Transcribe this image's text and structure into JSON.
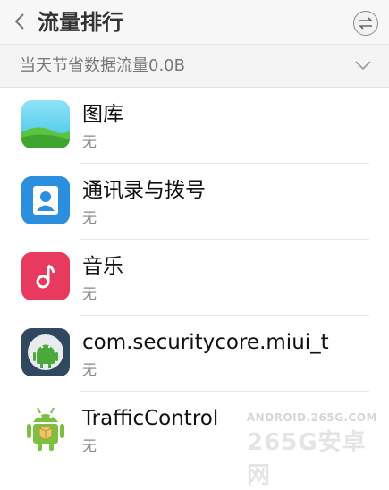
{
  "header": {
    "title": "流量排行",
    "back_icon": "chevron-left-icon",
    "sort_icon": "sort-arrows-icon"
  },
  "summary": {
    "text": "当天节省数据流量0.0B",
    "expand_icon": "chevron-down-icon"
  },
  "apps": [
    {
      "name": "图库",
      "usage": "无",
      "icon": "gallery-icon"
    },
    {
      "name": "通讯录与拨号",
      "usage": "无",
      "icon": "contacts-icon"
    },
    {
      "name": "音乐",
      "usage": "无",
      "icon": "music-icon"
    },
    {
      "name": "com.securitycore.miui_t",
      "usage": "无",
      "icon": "android-icon"
    },
    {
      "name": "TrafficControl",
      "usage": "无",
      "icon": "android-robot-icon"
    }
  ],
  "watermark": {
    "top": "ANDROID.265G.COM",
    "main": "265G安卓网"
  },
  "colors": {
    "header_bg": "#f7f7f7",
    "summary_bg": "#f4f4f4",
    "gallery_sky": "#3fc3e6",
    "gallery_grass": "#5cc241",
    "contacts_blue": "#2b8fe0",
    "music_red": "#e83a5e",
    "android_dark": "#2f4860",
    "android_green": "#7dc040"
  }
}
